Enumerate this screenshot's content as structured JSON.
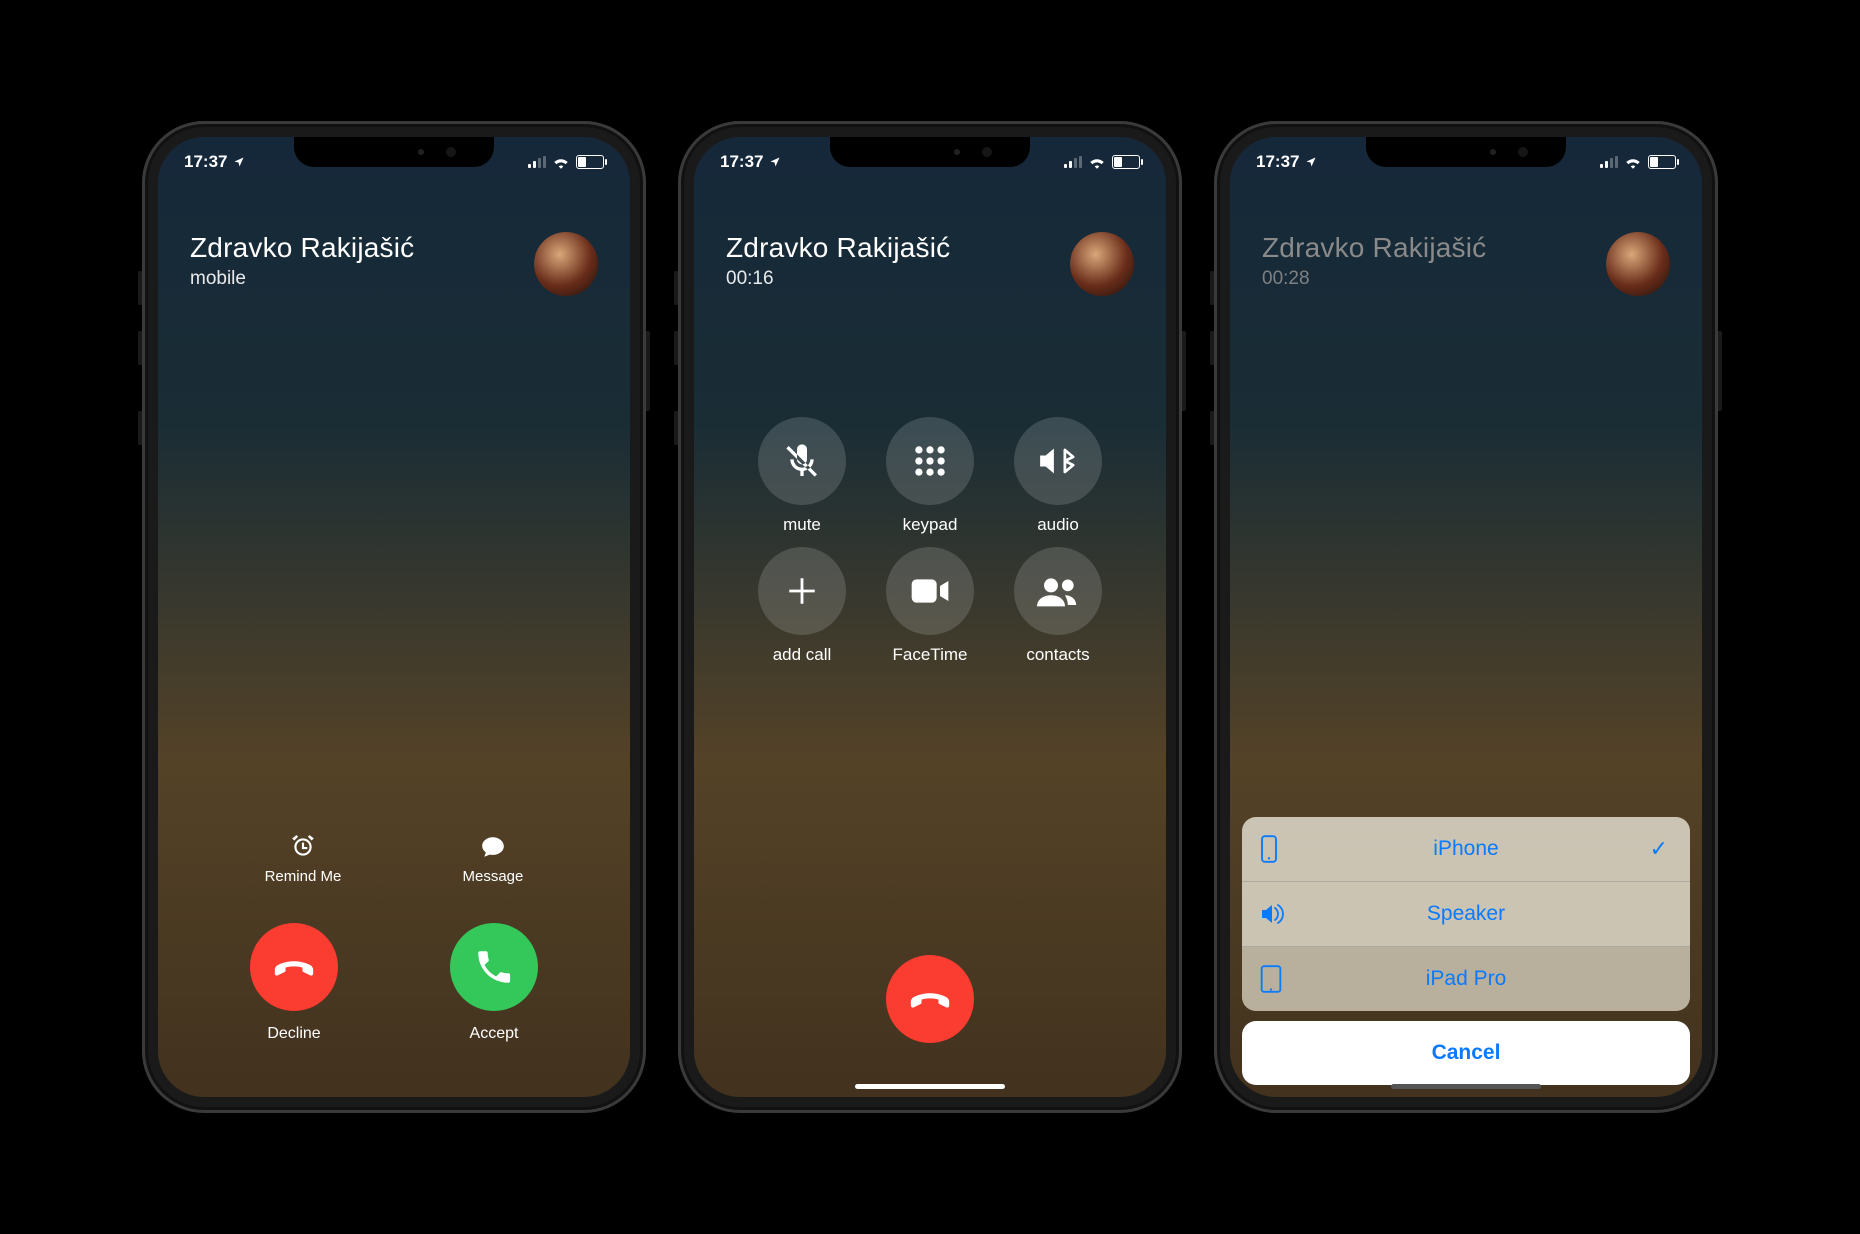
{
  "status": {
    "time": "17:37"
  },
  "caller": {
    "name": "Zdravko Rakijašić"
  },
  "screen1": {
    "sub": "mobile",
    "remind": "Remind Me",
    "message": "Message",
    "decline": "Decline",
    "accept": "Accept"
  },
  "screen2": {
    "duration": "00:16",
    "mute": "mute",
    "keypad": "keypad",
    "audio": "audio",
    "addcall": "add call",
    "facetime": "FaceTime",
    "contacts": "contacts"
  },
  "screen3": {
    "duration": "00:28",
    "iphone": "iPhone",
    "speaker": "Speaker",
    "ipad": "iPad Pro",
    "cancel": "Cancel"
  }
}
